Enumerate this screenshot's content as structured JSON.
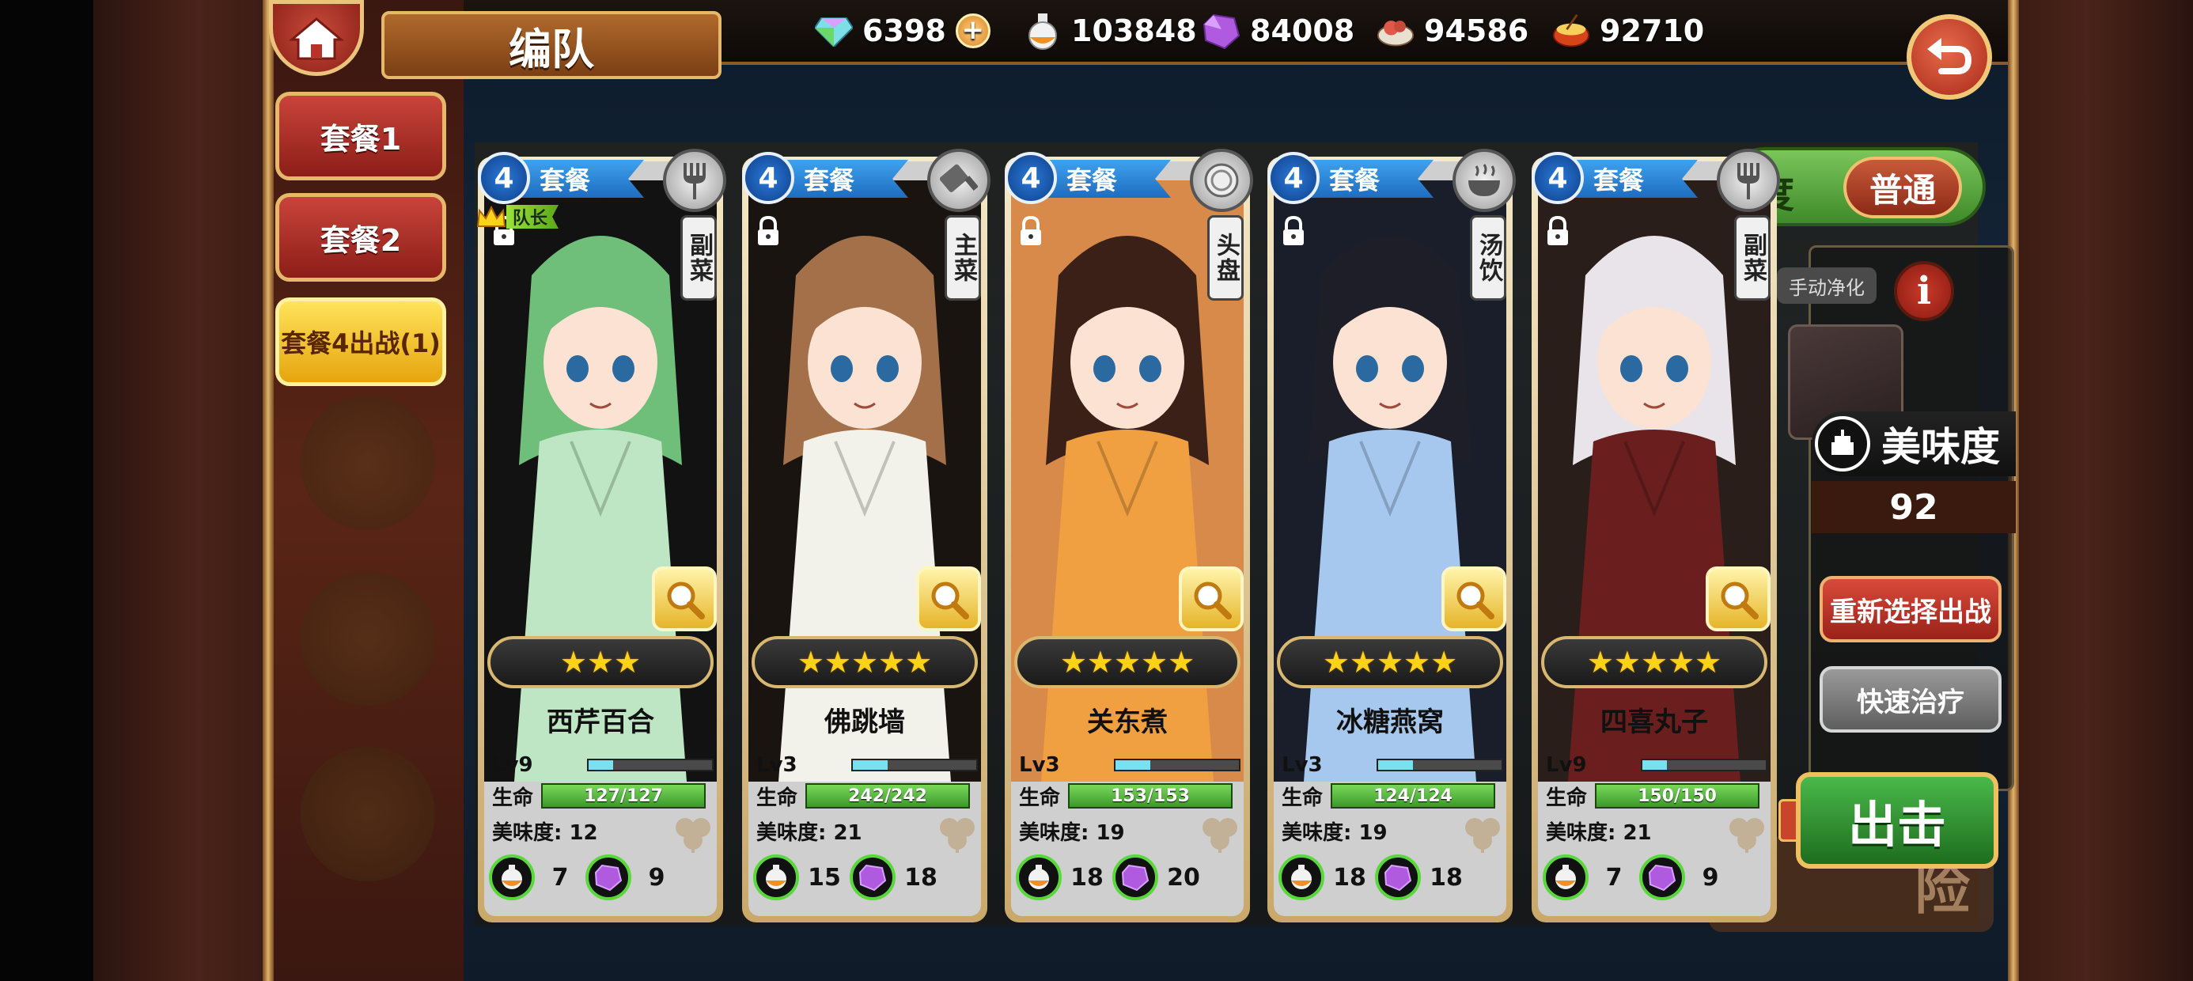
{
  "header": {
    "title": "编队",
    "resources": [
      {
        "icon": "diamond-icon",
        "value": "6398"
      },
      {
        "icon": "potion-icon",
        "value": "103848"
      },
      {
        "icon": "purple-crystal-icon",
        "value": "84008"
      },
      {
        "icon": "meat-bowl-icon",
        "value": "94586"
      },
      {
        "icon": "rice-bowl-icon",
        "value": "92710"
      }
    ]
  },
  "menu": {
    "set1": "套餐1",
    "set2": "套餐2",
    "set4": "套餐4出战(1)"
  },
  "background": {
    "difficulty_label": "度",
    "difficulty_value": "普通",
    "explore": "险"
  },
  "right_panel": {
    "manual_purify": "手动净化",
    "info": "i",
    "taste_label": "美味度",
    "taste_value": "92",
    "reselect_label": "重新选择出战",
    "quick_heal_label": "快速治疗",
    "attack_label": "出击"
  },
  "cards": [
    {
      "level_badge": "4",
      "type": "套餐",
      "role": "副菜",
      "dish_icon": "fork-icon",
      "leader": "队长",
      "stars": 3,
      "stars_text": "★★★",
      "name": "西芹百合",
      "lv": "Lv9",
      "exp": 0.2,
      "hp_label": "生命",
      "hp": "127/127",
      "taste": "美味度: 12",
      "cost1": "7",
      "cost2": "9",
      "palette": {
        "hair": "#6fbf7a",
        "bg": "#121212",
        "dress": "#bfe6c4"
      }
    },
    {
      "level_badge": "4",
      "type": "套餐",
      "role": "主菜",
      "dish_icon": "cleaver-icon",
      "leader": "",
      "stars": 5,
      "stars_text": "★★★★★",
      "name": "佛跳墙",
      "lv": "Lv3",
      "exp": 0.28,
      "hp_label": "生命",
      "hp": "242/242",
      "taste": "美味度: 21",
      "cost1": "15",
      "cost2": "18",
      "palette": {
        "hair": "#a3704a",
        "bg": "#1a1410",
        "dress": "#f2f2ea"
      }
    },
    {
      "level_badge": "4",
      "type": "套餐",
      "role": "头盘",
      "dish_icon": "plate-icon",
      "leader": "",
      "stars": 5,
      "stars_text": "★★★★★",
      "name": "关东煮",
      "lv": "Lv3",
      "exp": 0.28,
      "hp_label": "生命",
      "hp": "153/153",
      "taste": "美味度: 19",
      "cost1": "18",
      "cost2": "20",
      "palette": {
        "hair": "#3a2016",
        "bg": "#d88a4a",
        "dress": "#f0a040"
      }
    },
    {
      "level_badge": "4",
      "type": "套餐",
      "role": "汤饮",
      "dish_icon": "soup-bowl-icon",
      "leader": "",
      "stars": 5,
      "stars_text": "★★★★★",
      "name": "冰糖燕窝",
      "lv": "Lv3",
      "exp": 0.28,
      "hp_label": "生命",
      "hp": "124/124",
      "taste": "美味度: 19",
      "cost1": "18",
      "cost2": "18",
      "palette": {
        "hair": "#1e1e28",
        "bg": "#1a1e2a",
        "dress": "#a6c8ee"
      }
    },
    {
      "level_badge": "4",
      "type": "套餐",
      "role": "副菜",
      "dish_icon": "fork-icon",
      "leader": "",
      "stars": 5,
      "stars_text": "★★★★★",
      "name": "四喜丸子",
      "lv": "Lv9",
      "exp": 0.2,
      "hp_label": "生命",
      "hp": "150/150",
      "taste": "美味度: 21",
      "cost1": "7",
      "cost2": "9",
      "palette": {
        "hair": "#e8e4ea",
        "bg": "#2a1e1a",
        "dress": "#6a1e1e"
      }
    }
  ]
}
